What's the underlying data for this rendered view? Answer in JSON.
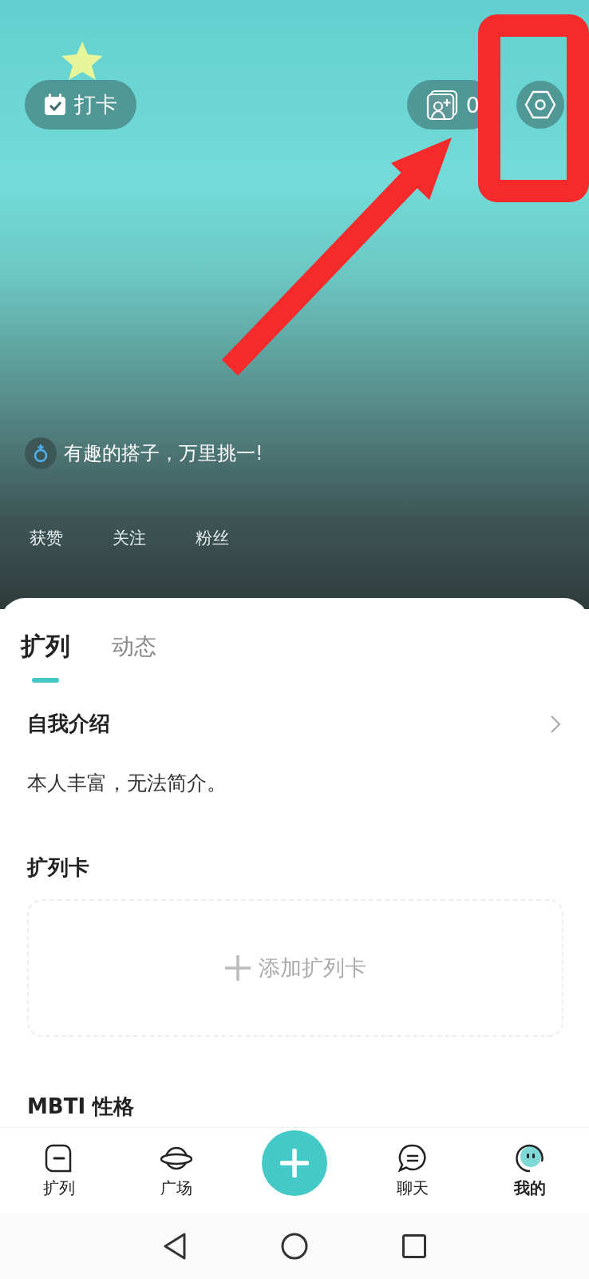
{
  "header": {
    "checkin_button": "打卡",
    "cards_count": "0",
    "slogan": "有趣的搭子，万里挑一!",
    "stats": [
      "获赞",
      "关注",
      "粉丝"
    ]
  },
  "tabs": [
    {
      "label": "扩列",
      "selected": true
    },
    {
      "label": "动态",
      "selected": false
    }
  ],
  "intro": {
    "title": "自我介绍",
    "text": "本人丰富，无法简介。"
  },
  "card_section": {
    "title": "扩列卡",
    "add_label": "添加扩列卡"
  },
  "mbti": {
    "title": "MBTI 性格"
  },
  "bottom_nav": [
    {
      "kind": "tab",
      "label": "扩列",
      "selected": false
    },
    {
      "kind": "tab",
      "label": "广场",
      "selected": false
    },
    {
      "kind": "add"
    },
    {
      "kind": "tab",
      "label": "聊天",
      "selected": false
    },
    {
      "kind": "tab",
      "label": "我的",
      "selected": true
    }
  ]
}
